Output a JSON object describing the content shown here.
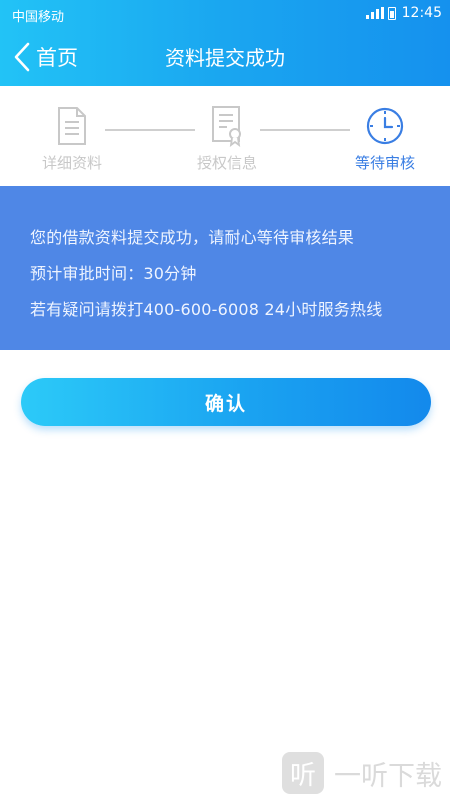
{
  "status_bar": {
    "carrier": "中国移动",
    "time": "12:45"
  },
  "navbar": {
    "back_label": "首页",
    "title": "资料提交成功"
  },
  "steps": [
    {
      "label": "详细资料",
      "icon": "document-icon",
      "active": false
    },
    {
      "label": "授权信息",
      "icon": "certificate-icon",
      "active": false
    },
    {
      "label": "等待审核",
      "icon": "clock-icon",
      "active": true
    }
  ],
  "info": {
    "line1": "您的借款资料提交成功，请耐心等待审核结果",
    "line2": "预计审批时间：30分钟",
    "line3": "若有疑问请拨打400-600-6008 24小时服务热线"
  },
  "confirm_label": "确认",
  "watermark": {
    "logo_glyph": "听",
    "text": "一听下载"
  },
  "colors": {
    "header_gradient_start": "#22c3f6",
    "header_gradient_end": "#1591ee",
    "info_background": "#4f87e6",
    "active_step": "#3a7ee3",
    "inactive_step": "#c8c8c8"
  }
}
